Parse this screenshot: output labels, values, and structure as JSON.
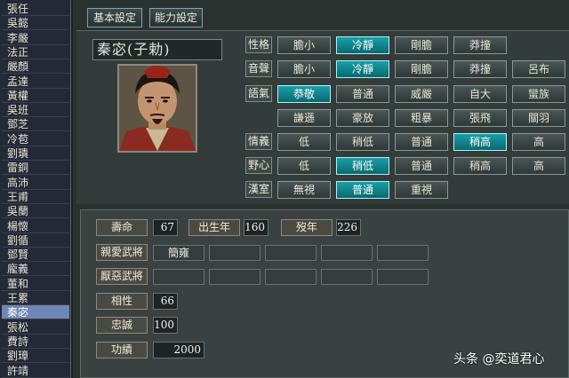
{
  "names": [
    "張任",
    "吳懿",
    "李嚴",
    "法正",
    "嚴顏",
    "孟達",
    "黃權",
    "吳班",
    "鄧芝",
    "冷苞",
    "劉璝",
    "雷銅",
    "高沛",
    "王甫",
    "吳蘭",
    "楊懷",
    "劉循",
    "鄧賢",
    "龐義",
    "董和",
    "王累",
    "秦宓",
    "張松",
    "費詩",
    "劉璋",
    "許靖"
  ],
  "selected_name_index": 21,
  "tabs": [
    {
      "label": "基本設定",
      "active": true
    },
    {
      "label": "能力設定",
      "active": false
    }
  ],
  "officer_name": "秦宓(子勅)",
  "rows": [
    {
      "label": "性格",
      "options": [
        "膽小",
        "冷靜",
        "剛膽",
        "莽撞"
      ],
      "active": 1
    },
    {
      "label": "音聲",
      "options": [
        "膽小",
        "冷靜",
        "剛膽",
        "莽撞",
        "呂布"
      ],
      "active": 1
    },
    {
      "label": "語氣",
      "options": [
        "恭敬",
        "普通",
        "威嚴",
        "自大",
        "蠻族"
      ],
      "active": 0
    },
    {
      "label": "",
      "options": [
        "謙遜",
        "豪放",
        "粗暴",
        "張飛",
        "關羽"
      ],
      "active": -1
    },
    {
      "label": "情義",
      "options": [
        "低",
        "稍低",
        "普通",
        "稍高",
        "高"
      ],
      "active": 3
    },
    {
      "label": "野心",
      "options": [
        "低",
        "稍低",
        "普通",
        "稍高",
        "高"
      ],
      "active": 1
    },
    {
      "label": "漢室",
      "options": [
        "無視",
        "普通",
        "重視"
      ],
      "active": 1
    }
  ],
  "stats": {
    "lifespan_label": "壽命",
    "lifespan_value": "67",
    "birth_label": "出生年",
    "birth_value": "160",
    "death_label": "歿年",
    "death_value": "226",
    "liked_label": "親愛武將",
    "liked_values": [
      "簡雍",
      "",
      "",
      "",
      ""
    ],
    "disliked_label": "厭惡武將",
    "disliked_values": [
      "",
      "",
      "",
      "",
      ""
    ],
    "compat_label": "相性",
    "compat_value": "66",
    "loyalty_label": "忠誠",
    "loyalty_value": "100",
    "merit_label": "功績",
    "merit_value": "2000"
  },
  "watermark": "头条 @奕道君心",
  "colors": {
    "active": "#18a0a8",
    "selected_list": "#6f86b8"
  }
}
